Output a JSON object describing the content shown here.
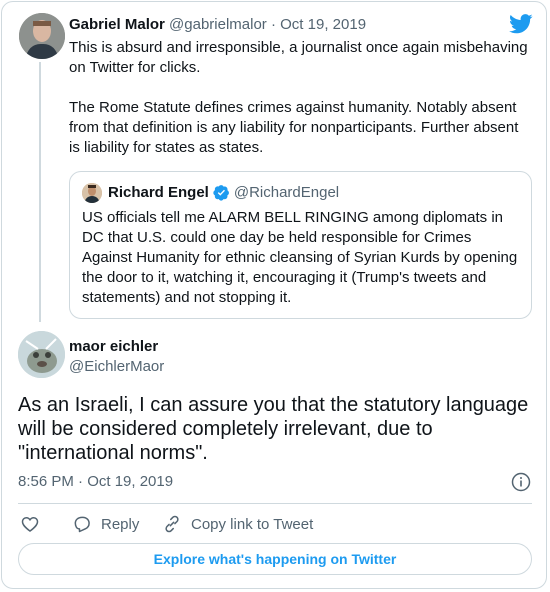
{
  "colors": {
    "accent": "#1d9bf0",
    "muted": "#536471",
    "border": "#cfd9de",
    "text": "#0f1419"
  },
  "parent_tweet": {
    "name": "Gabriel Malor",
    "handle": "@gabrielmalor",
    "separator": "·",
    "date": "Oct 19, 2019",
    "paragraph1": "This is absurd and irresponsible, a journalist once again misbehaving on Twitter for clicks.",
    "paragraph2": "The Rome Statute defines crimes against humanity. Notably absent from that definition is any liability for nonparticipants. Further absent is liability for states as states."
  },
  "quoted_tweet": {
    "name": "Richard Engel",
    "handle": "@RichardEngel",
    "text": "US officials tell me ALARM BELL RINGING among diplomats in DC that U.S. could one day be held responsible for Crimes Against Humanity for ethnic cleansing of Syrian Kurds by opening the door to it, watching it, encouraging it (Trump's tweets and statements) and not stopping it."
  },
  "main_tweet": {
    "name": "maor eichler",
    "handle": "@EichlerMaor",
    "text": "As an Israeli, I can assure you that the statutory language will be considered completely irrelevant, due to \"international norms\".",
    "timestamp": "8:56 PM · Oct 19, 2019"
  },
  "actions": {
    "reply": "Reply",
    "copy_link": "Copy link to Tweet"
  },
  "explore_button": "Explore what's happening on Twitter",
  "icons": [
    "twitter-bird-icon",
    "verified-badge-icon",
    "info-icon",
    "heart-icon",
    "reply-icon",
    "link-icon"
  ]
}
